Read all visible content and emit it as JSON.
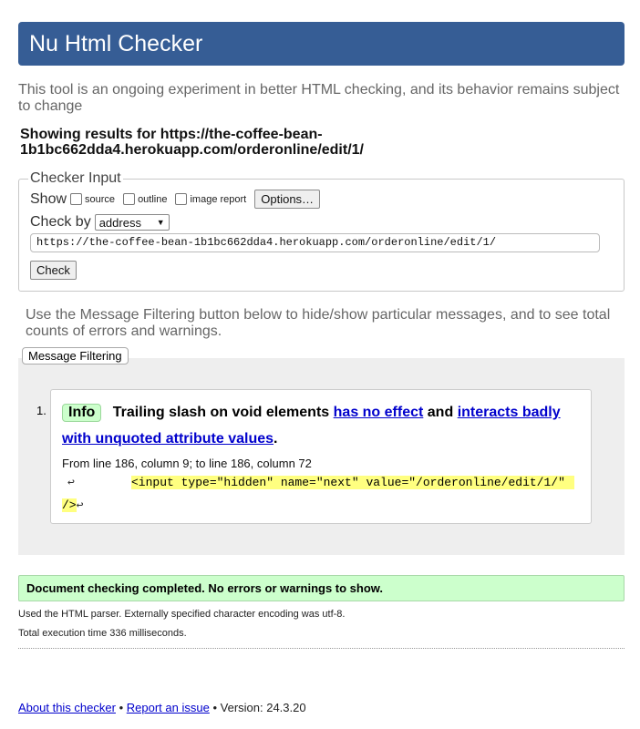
{
  "header": {
    "title": "Nu Html Checker"
  },
  "intro": "This tool is an ongoing experiment in better HTML checking, and its behavior remains subject to change",
  "showing": "Showing results for https://the-coffee-bean-1b1bc662dda4.herokuapp.com/orderonline/edit/1/",
  "checker_input": {
    "legend": "Checker Input",
    "show_label": "Show",
    "options": [
      {
        "label": "source",
        "checked": false
      },
      {
        "label": "outline",
        "checked": false
      },
      {
        "label": "image report",
        "checked": false
      }
    ],
    "options_button": "Options…",
    "check_by_label": "Check by",
    "check_by_value": "address",
    "url_value": "https://the-coffee-bean-1b1bc662dda4.herokuapp.com/orderonline/edit/1/",
    "check_button": "Check"
  },
  "filter_note": "Use the Message Filtering button below to hide/show particular messages, and to see total counts of errors and warnings.",
  "filter_button": "Message Filtering",
  "messages": [
    {
      "number": "1.",
      "type": "Info",
      "text_before": "Trailing slash on void elements",
      "link1": "has no effect",
      "text_mid": "and",
      "link2": "interacts badly with unquoted attribute values",
      "text_after": ".",
      "location": "From line 186, column 9; to line 186, column 72",
      "code_line1": "<input type=\"hidden\" name=\"next\" value=\"/orderonline/edit/1/\"",
      "code_line2": "/>",
      "lf_glyph": "↩"
    }
  ],
  "status": "Document checking completed. No errors or warnings to show.",
  "details": [
    "Used the HTML parser. Externally specified character encoding was utf-8.",
    "Total execution time 336 milliseconds."
  ],
  "footer": {
    "about": "About this checker",
    "sep1": "•",
    "report": "Report an issue",
    "sep2": "•",
    "version": "Version: 24.3.20"
  },
  "colors": {
    "header_bg": "#365d95",
    "info_badge": "#ccffcc",
    "highlight": "#ffff80",
    "link": "#0000cc"
  }
}
